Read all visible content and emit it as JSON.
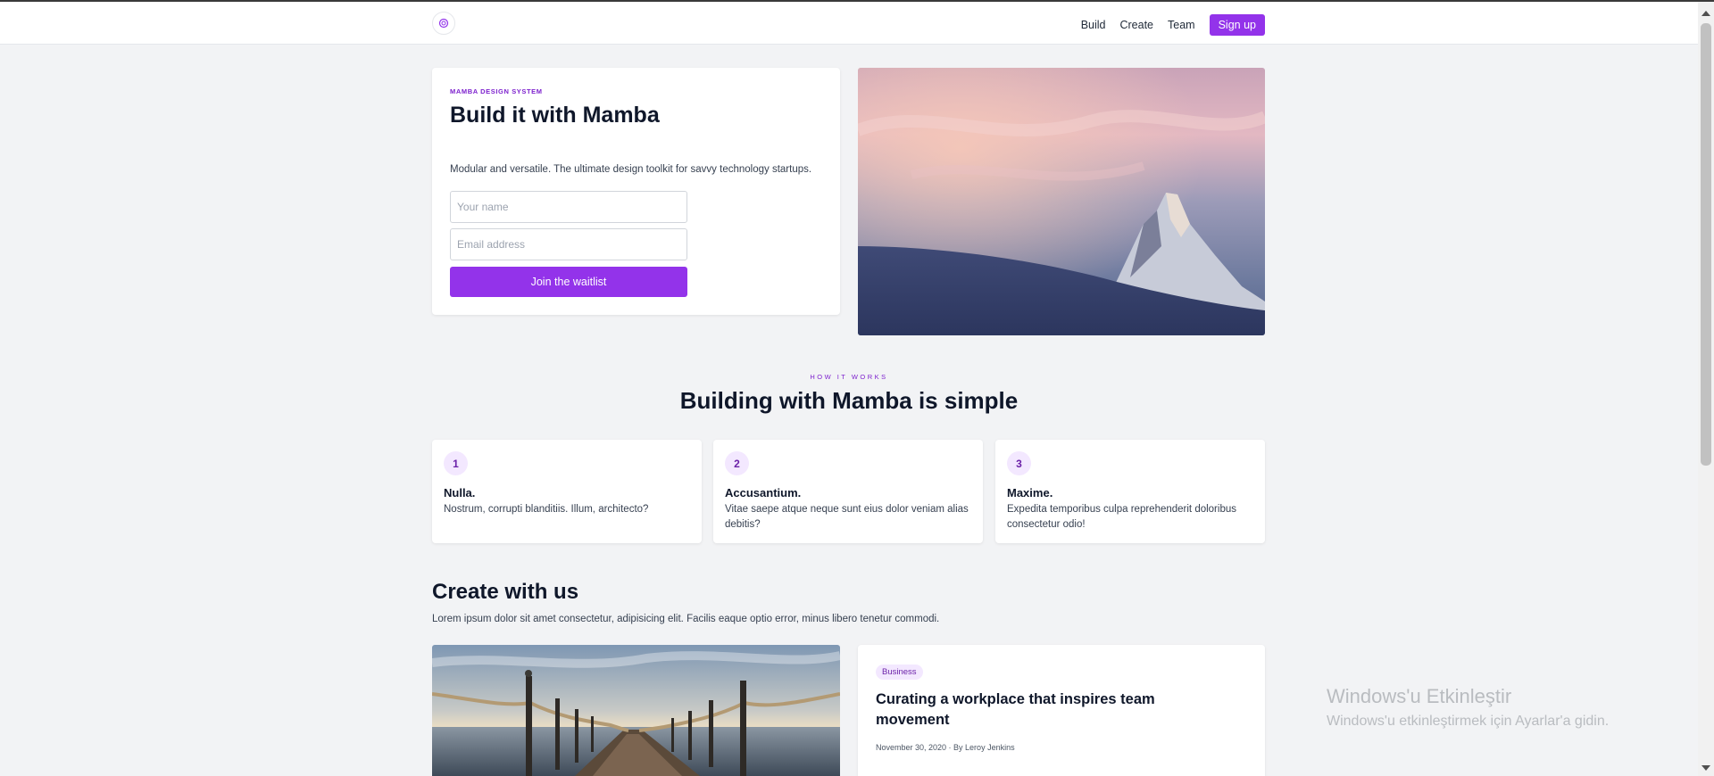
{
  "nav": {
    "logo_icon": "mamba-logo-icon",
    "links": [
      "Build",
      "Create",
      "Team"
    ],
    "signup_label": "Sign up"
  },
  "hero": {
    "eyebrow": "MAMBA DESIGN SYSTEM",
    "title": "Build it with Mamba",
    "description": "Modular and versatile. The ultimate design toolkit for savvy technology startups.",
    "name_placeholder": "Your name",
    "email_placeholder": "Email address",
    "name_value": "",
    "email_value": "",
    "cta_label": "Join the waitlist",
    "image_icon": "snowy-mountain-sunset-image"
  },
  "how": {
    "eyebrow": "HOW IT WORKS",
    "title": "Building with Mamba is simple",
    "steps": [
      {
        "number": "1",
        "title": "Nulla.",
        "body": "Nostrum, corrupti blanditiis. Illum, architecto?"
      },
      {
        "number": "2",
        "title": "Accusantium.",
        "body": "Vitae saepe atque neque sunt eius dolor veniam alias debitis?"
      },
      {
        "number": "3",
        "title": "Maxime.",
        "body": "Expedita temporibus culpa reprehenderit doloribus consectetur odio!"
      }
    ]
  },
  "create": {
    "title": "Create with us",
    "description": "Lorem ipsum dolor sit amet consectetur, adipisicing elit. Facilis eaque optio error, minus libero tenetur commodi.",
    "post": {
      "image_icon": "pier-at-sea-image",
      "badge": "Business",
      "title": "Curating a workplace that inspires team movement",
      "meta": "November 30, 2020 · By Leroy Jenkins"
    }
  },
  "watermark": {
    "title": "Windows'u Etkinleştir",
    "subtitle": "Windows'u etkinleştirmek için Ayarlar'a gidin."
  },
  "colors": {
    "accent": "#9333ea",
    "accent_light": "#f3e8ff",
    "page_bg": "#f2f3f5",
    "heading": "#0f172a"
  }
}
